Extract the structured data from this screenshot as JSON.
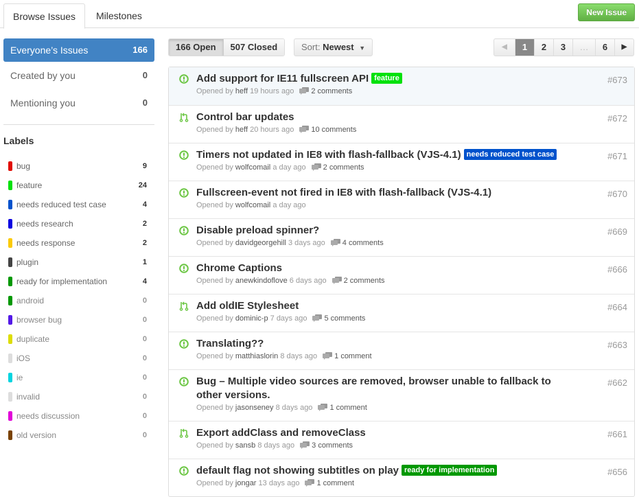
{
  "tabs": [
    {
      "label": "Browse Issues",
      "active": true
    },
    {
      "label": "Milestones",
      "active": false
    }
  ],
  "new_issue_label": "New Issue",
  "nav": [
    {
      "label": "Everyone’s Issues",
      "count": "166"
    },
    {
      "label": "Created by you",
      "count": "0"
    },
    {
      "label": "Mentioning you",
      "count": "0"
    }
  ],
  "labels_heading": "Labels",
  "labels": [
    {
      "name": "bug",
      "count": "9",
      "color": "#e10c02"
    },
    {
      "name": "feature",
      "count": "24",
      "color": "#02e10c"
    },
    {
      "name": "needs reduced test case",
      "count": "4",
      "color": "#0052cc"
    },
    {
      "name": "needs research",
      "count": "2",
      "color": "#0b02e1"
    },
    {
      "name": "needs response",
      "count": "2",
      "color": "#fbca04"
    },
    {
      "name": "plugin",
      "count": "1",
      "color": "#444444"
    },
    {
      "name": "ready for implementation",
      "count": "4",
      "color": "#009800"
    },
    {
      "name": "android",
      "count": "0",
      "color": "#009800"
    },
    {
      "name": "browser bug",
      "count": "0",
      "color": "#5319e7"
    },
    {
      "name": "duplicate",
      "count": "0",
      "color": "#dddd00"
    },
    {
      "name": "iOS",
      "count": "0",
      "color": "#dddddd"
    },
    {
      "name": "ie",
      "count": "0",
      "color": "#00d4e0"
    },
    {
      "name": "invalid",
      "count": "0",
      "color": "#dddddd"
    },
    {
      "name": "needs discussion",
      "count": "0",
      "color": "#e102d8"
    },
    {
      "name": "old version",
      "count": "0",
      "color": "#7a4200"
    }
  ],
  "filters": {
    "open": "166 Open",
    "closed": "507 Closed",
    "sort_prefix": "Sort:",
    "sort_value": "Newest"
  },
  "pager": {
    "prev": "◀",
    "pages": [
      "1",
      "2",
      "3",
      "…",
      "6"
    ],
    "current": "1",
    "next": "▶"
  },
  "issues": [
    {
      "type": "issue",
      "title": "Add support for IE11 fullscreen API",
      "label": "feature",
      "label_color": "#02e10c",
      "author": "heff",
      "age": "19 hours ago",
      "comments": "2 comments",
      "number": "#673"
    },
    {
      "type": "pull",
      "title": "Control bar updates",
      "label": "",
      "label_color": "",
      "author": "heff",
      "age": "20 hours ago",
      "comments": "10 comments",
      "number": "#672"
    },
    {
      "type": "issue",
      "title": "Timers not updated in IE8 with flash-fallback (VJS-4.1)",
      "label": "needs reduced test case",
      "label_color": "#0052cc",
      "author": "wolfcomail",
      "age": "a day ago",
      "comments": "2 comments",
      "number": "#671"
    },
    {
      "type": "issue",
      "title": "Fullscreen-event not fired in IE8 with flash-fallback (VJS-4.1)",
      "label": "",
      "label_color": "",
      "author": "wolfcomail",
      "age": "a day ago",
      "comments": "",
      "number": "#670"
    },
    {
      "type": "issue",
      "title": "Disable preload spinner?",
      "label": "",
      "label_color": "",
      "author": "davidgeorgehill",
      "age": "3 days ago",
      "comments": "4 comments",
      "number": "#669"
    },
    {
      "type": "issue",
      "title": "Chrome Captions",
      "label": "",
      "label_color": "",
      "author": "anewkindoflove",
      "age": "6 days ago",
      "comments": "2 comments",
      "number": "#666"
    },
    {
      "type": "pull",
      "title": "Add oldIE Stylesheet",
      "label": "",
      "label_color": "",
      "author": "dominic-p",
      "age": "7 days ago",
      "comments": "5 comments",
      "number": "#664"
    },
    {
      "type": "issue",
      "title": "Translating??",
      "label": "",
      "label_color": "",
      "author": "matthiaslorin",
      "age": "8 days ago",
      "comments": "1 comment",
      "number": "#663"
    },
    {
      "type": "issue",
      "title": "Bug – Multiple video sources are removed, browser unable to fallback to other versions.",
      "label": "",
      "label_color": "",
      "author": "jasonseney",
      "age": "8 days ago",
      "comments": "1 comment",
      "number": "#662"
    },
    {
      "type": "pull",
      "title": "Export addClass and removeClass",
      "label": "",
      "label_color": "",
      "author": "sansb",
      "age": "8 days ago",
      "comments": "3 comments",
      "number": "#661"
    },
    {
      "type": "issue",
      "title": "default flag not showing subtitles on play",
      "label": "ready for implementation",
      "label_color": "#009800",
      "author": "jongar",
      "age": "13 days ago",
      "comments": "1 comment",
      "number": "#656"
    }
  ],
  "opened_by": "Opened by"
}
